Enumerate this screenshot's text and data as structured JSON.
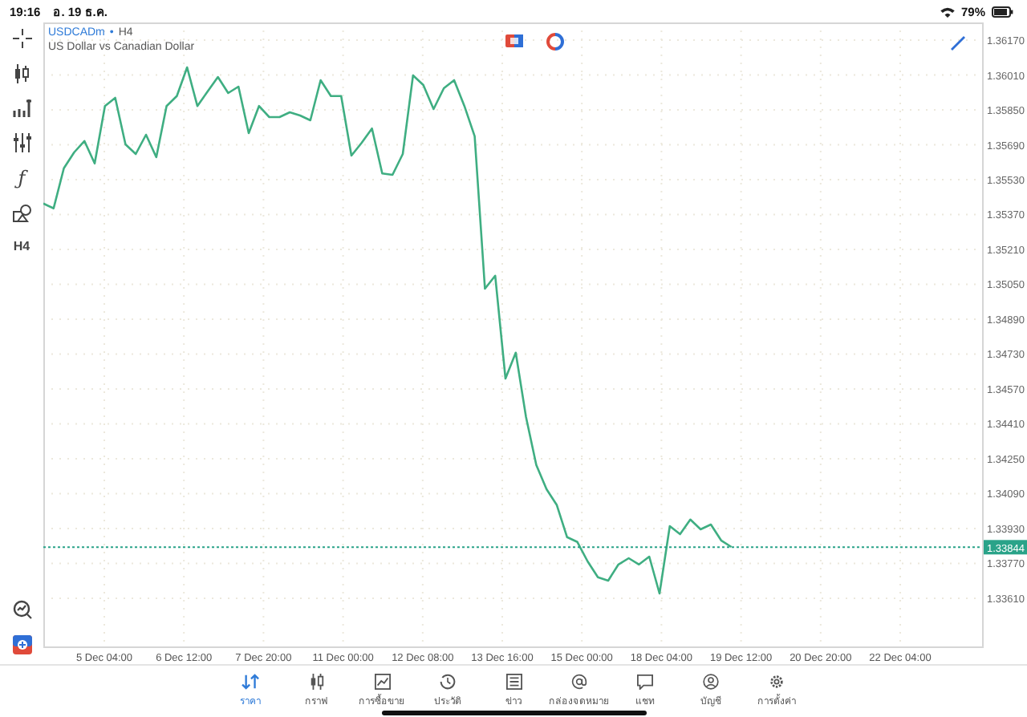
{
  "status_bar": {
    "time": "19:16",
    "date": "อ. 19 ธ.ค.",
    "battery": "79%"
  },
  "chart_header": {
    "separator": "•",
    "timeframe": "H4",
    "description": "US Dollar vs Canadian Dollar"
  },
  "left_toolbar": {
    "function_symbol": "ƒ",
    "timeframe_label": "H4"
  },
  "chart": {
    "chart_data": {
      "type": "line",
      "series": [
        {
          "name": "USDCADm",
          "color": "#3fae82",
          "values": [
            1.3542,
            1.35398,
            1.35582,
            1.35655,
            1.35707,
            1.35604,
            1.35868,
            1.35905,
            1.35692,
            1.35648,
            1.35736,
            1.35633,
            1.35868,
            1.35913,
            1.36045,
            1.35868,
            1.35935,
            1.36001,
            1.35927,
            1.35957,
            1.35743,
            1.35868,
            1.35817,
            1.35817,
            1.35839,
            1.35824,
            1.35802,
            1.35986,
            1.35913,
            1.35913,
            1.3564,
            1.35699,
            1.35765,
            1.35559,
            1.35552,
            1.35648,
            1.36008,
            1.35964,
            1.35854,
            1.35949,
            1.35986,
            1.35868,
            1.35729,
            1.3503,
            1.35089,
            1.34618,
            1.34736,
            1.34441,
            1.34221,
            1.3411,
            1.34037,
            1.3389,
            1.33868,
            1.33779,
            1.33706,
            1.33691,
            1.33765,
            1.33794,
            1.33765,
            1.33801,
            1.33632,
            1.33941,
            1.33904,
            1.33971,
            1.33926,
            1.33948,
            1.33875,
            1.33845
          ]
        }
      ],
      "ylim": [
        1.33389,
        1.36251
      ],
      "grid": true,
      "yticks": [
        {
          "value": 1.3617,
          "label": "1.36170"
        },
        {
          "value": 1.3601,
          "label": "1.36010"
        },
        {
          "value": 1.3585,
          "label": "1.35850"
        },
        {
          "value": 1.3569,
          "label": "1.35690"
        },
        {
          "value": 1.3553,
          "label": "1.35530"
        },
        {
          "value": 1.3537,
          "label": "1.35370"
        },
        {
          "value": 1.3521,
          "label": "1.35210"
        },
        {
          "value": 1.3505,
          "label": "1.35050"
        },
        {
          "value": 1.3489,
          "label": "1.34890"
        },
        {
          "value": 1.3473,
          "label": "1.34730"
        },
        {
          "value": 1.3457,
          "label": "1.34570"
        },
        {
          "value": 1.3441,
          "label": "1.34410"
        },
        {
          "value": 1.3425,
          "label": "1.34250"
        },
        {
          "value": 1.3409,
          "label": "1.34090"
        },
        {
          "value": 1.3393,
          "label": "1.33930"
        },
        {
          "value": 1.3377,
          "label": "1.33770"
        },
        {
          "value": 1.3361,
          "label": "1.33610"
        }
      ],
      "ref_lines": [
        {
          "axis": "y",
          "value": 1.33844,
          "label": "1.33844"
        }
      ]
    },
    "time_axis_labels": [
      "5 Dec 04:00",
      "6 Dec 12:00",
      "7 Dec 20:00",
      "11 Dec 00:00",
      "12 Dec 08:00",
      "13 Dec 16:00",
      "15 Dec 00:00",
      "18 Dec 04:00",
      "19 Dec 12:00",
      "20 Dec 20:00",
      "22 Dec 04:00"
    ]
  },
  "tab_bar": [
    {
      "label": "ราคา",
      "selected": true
    },
    {
      "label": "กราฟ",
      "selected": false
    },
    {
      "label": "การซื้อขาย",
      "selected": false
    },
    {
      "label": "ประวัติ",
      "selected": false
    },
    {
      "label": "ข่าว",
      "selected": false
    },
    {
      "label": "กล่องจดหมาย",
      "selected": false
    },
    {
      "label": "แชท",
      "selected": false
    },
    {
      "label": "บัญชี",
      "selected": false
    },
    {
      "label": "การตั้งค่า",
      "selected": false
    }
  ]
}
